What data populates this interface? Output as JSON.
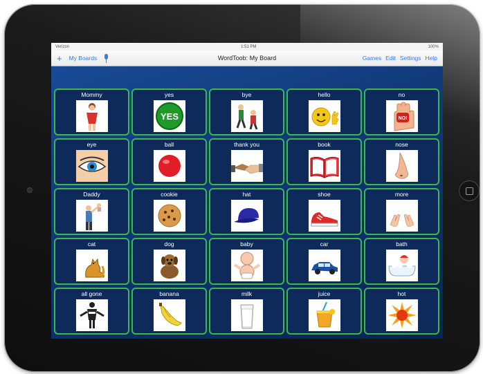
{
  "statusbar": {
    "carrier": "Verizon",
    "time": "1:51 PM",
    "battery": "100%"
  },
  "navbar": {
    "my_boards": "My Boards",
    "title": "WordToob: My Board",
    "actions": [
      "Games",
      "Edit",
      "Settings",
      "Help"
    ]
  },
  "tiles": [
    {
      "label": "Mommy",
      "icon": "mommy-icon"
    },
    {
      "label": "yes",
      "icon": "yes-icon"
    },
    {
      "label": "bye",
      "icon": "bye-icon"
    },
    {
      "label": "hello",
      "icon": "hello-icon"
    },
    {
      "label": "no",
      "icon": "no-icon"
    },
    {
      "label": "eye",
      "icon": "eye-icon"
    },
    {
      "label": "ball",
      "icon": "ball-icon"
    },
    {
      "label": "thank you",
      "icon": "thank-you-icon"
    },
    {
      "label": "book",
      "icon": "book-icon"
    },
    {
      "label": "nose",
      "icon": "nose-icon"
    },
    {
      "label": "Daddy",
      "icon": "daddy-icon"
    },
    {
      "label": "cookie",
      "icon": "cookie-icon"
    },
    {
      "label": "hat",
      "icon": "hat-icon"
    },
    {
      "label": "shoe",
      "icon": "shoe-icon"
    },
    {
      "label": "more",
      "icon": "more-icon"
    },
    {
      "label": "cat",
      "icon": "cat-icon"
    },
    {
      "label": "dog",
      "icon": "dog-icon"
    },
    {
      "label": "baby",
      "icon": "baby-icon"
    },
    {
      "label": "car",
      "icon": "car-icon"
    },
    {
      "label": "bath",
      "icon": "bath-icon"
    },
    {
      "label": "all gone",
      "icon": "all-gone-icon"
    },
    {
      "label": "banana",
      "icon": "banana-icon"
    },
    {
      "label": "milk",
      "icon": "milk-icon"
    },
    {
      "label": "juice",
      "icon": "juice-icon"
    },
    {
      "label": "hot",
      "icon": "hot-icon"
    }
  ],
  "colors": {
    "accent": "#2f7ef0",
    "tile_border": "#3fb84a",
    "tile_bg": "#0d2a5a"
  }
}
